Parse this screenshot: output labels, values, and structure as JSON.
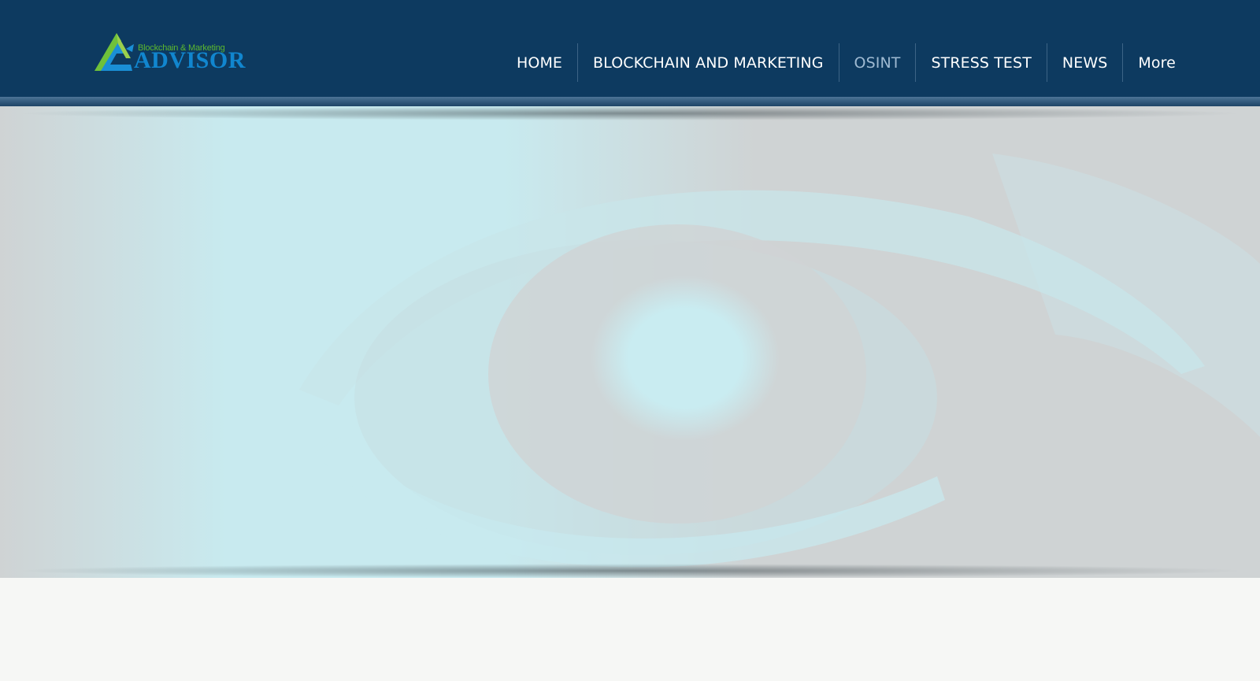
{
  "logo": {
    "tagline": "Blockchain & Marketing",
    "wordmark": "ADVISOR",
    "icon": "mountain-a-logo-mark"
  },
  "nav": {
    "items": [
      {
        "label": "HOME",
        "active": false
      },
      {
        "label": "BLOCKCHAIN AND MARKETING",
        "active": false
      },
      {
        "label": "OSINT",
        "active": true
      },
      {
        "label": "STRESS TEST",
        "active": false
      },
      {
        "label": "NEWS",
        "active": false
      },
      {
        "label": "More",
        "active": false
      }
    ]
  },
  "hero": {
    "image": "eye-closeup-image"
  },
  "colors": {
    "header_bg": "#0d3a60",
    "nav_text": "#ffffff",
    "nav_active_text": "#9fbad2",
    "logo_green": "#5cb82e",
    "logo_blue": "#1186cf",
    "hero_cyan": "#c8ebf0",
    "hero_grey": "#cfd3d4",
    "page_bg": "#f6f7f5"
  }
}
